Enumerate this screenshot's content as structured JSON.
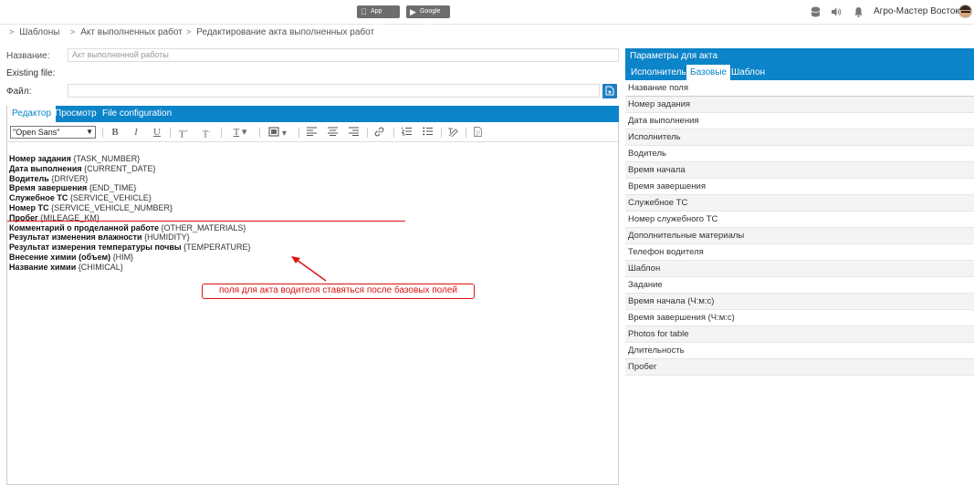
{
  "header": {
    "app_store_label": "App Store",
    "google_play_label": "Google Play",
    "user_name": "Агро-Мастер Восток"
  },
  "breadcrumb": [
    "Шаблоны",
    "Акт выполненных работ",
    "Редактирование акта выполненных работ"
  ],
  "form": {
    "name_label": "Название:",
    "name_value": "Акт выполненной работы",
    "existing_file_label": "Existing file:",
    "file_label": "Файл:",
    "file_value": ""
  },
  "editor": {
    "tabs": [
      "Редактор",
      "Просмотр",
      "File configuration"
    ],
    "active_tab": 0,
    "font_family_value": "\"Open Sans\"",
    "lines": [
      {
        "label": "Номер задания",
        "placeholder": "{TASK_NUMBER}"
      },
      {
        "label": "Дата выполнения",
        "placeholder": "{CURRENT_DATE}"
      },
      {
        "label": "Водитель",
        "placeholder": "{DRIVER}"
      },
      {
        "label": "Время завершения",
        "placeholder": "{END_TIME}"
      },
      {
        "label": "Служебное ТС",
        "placeholder": "{SERVICE_VEHICLE}"
      },
      {
        "label": "Номер ТС",
        "placeholder": "{SERVICE_VEHICLE_NUMBER}"
      },
      {
        "label": "Пробег",
        "placeholder": "{MILEAGE_KM}"
      },
      {
        "label": "Комментарий о проделанной работе",
        "placeholder": "{OTHER_MATERIALS}"
      },
      {
        "label": "Результат изменения влажности",
        "placeholder": "{HUMIDITY}"
      },
      {
        "label": "Результат измерения температуры почвы",
        "placeholder": "{TEMPERATURE}"
      },
      {
        "label": "Внесение химии (объем)",
        "placeholder": "{HIM}"
      },
      {
        "label": "Название химии",
        "placeholder": "{CHIMICAL}"
      }
    ]
  },
  "annotation": {
    "text": "поля для  акта водителя ставяться после базовых полей",
    "color": "#dd1111"
  },
  "params_panel": {
    "title": "Параметры для акта",
    "tabs": [
      "Исполнитель",
      "Базовые",
      "Шаблон"
    ],
    "active_tab": 1,
    "column_header": "Название поля",
    "fields": [
      "Номер задания",
      "Дата выполнения",
      "Исполнитель",
      "Водитель",
      "Время начала",
      "Время завершения",
      "Служебное ТС",
      "Номер служебного ТС",
      "Дополнительные материалы",
      "Телефон водителя",
      "Шаблон",
      "Задание",
      "Время начала (Ч:м:с)",
      "Время завершения (Ч:м:с)",
      "Photos for table",
      "Длительность",
      "Пробег"
    ]
  },
  "colors": {
    "accent": "#0c84c9",
    "annotation_red": "#dd1111"
  },
  "icons": {
    "header": [
      "database-icon",
      "volume-icon",
      "bell-icon"
    ],
    "toolbar": [
      "bold-icon",
      "italic-icon",
      "underline-icon",
      "font-size-up-icon",
      "font-size-down-icon",
      "text-color-icon",
      "background-color-icon",
      "align-left-icon",
      "align-center-icon",
      "align-right-icon",
      "link-icon",
      "ordered-list-icon",
      "unordered-list-icon",
      "clear-format-icon",
      "source-code-icon"
    ]
  }
}
